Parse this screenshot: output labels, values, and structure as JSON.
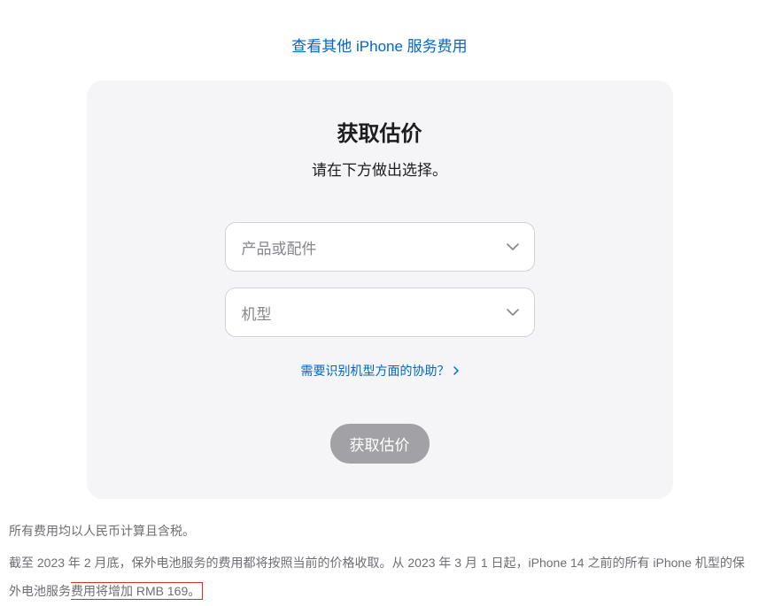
{
  "topLink": "查看其他 iPhone 服务费用",
  "card": {
    "title": "获取估价",
    "subtitle": "请在下方做出选择。",
    "select1": {
      "placeholder": "产品或配件"
    },
    "select2": {
      "placeholder": "机型"
    },
    "helpLink": "需要识别机型方面的协助？",
    "submit": "获取估价"
  },
  "footer": {
    "line1": "所有费用均以人民币计算且含税。",
    "line2a": "截至 2023 年 2 月底，保外电池服务的费用都将按照当前的价格收取。从 2023 年 3 月 1 日起，iPhone 14 之前的所有 iPhone 机型的保外电池服务",
    "line2b": "费用将增加 RMB 169。"
  }
}
